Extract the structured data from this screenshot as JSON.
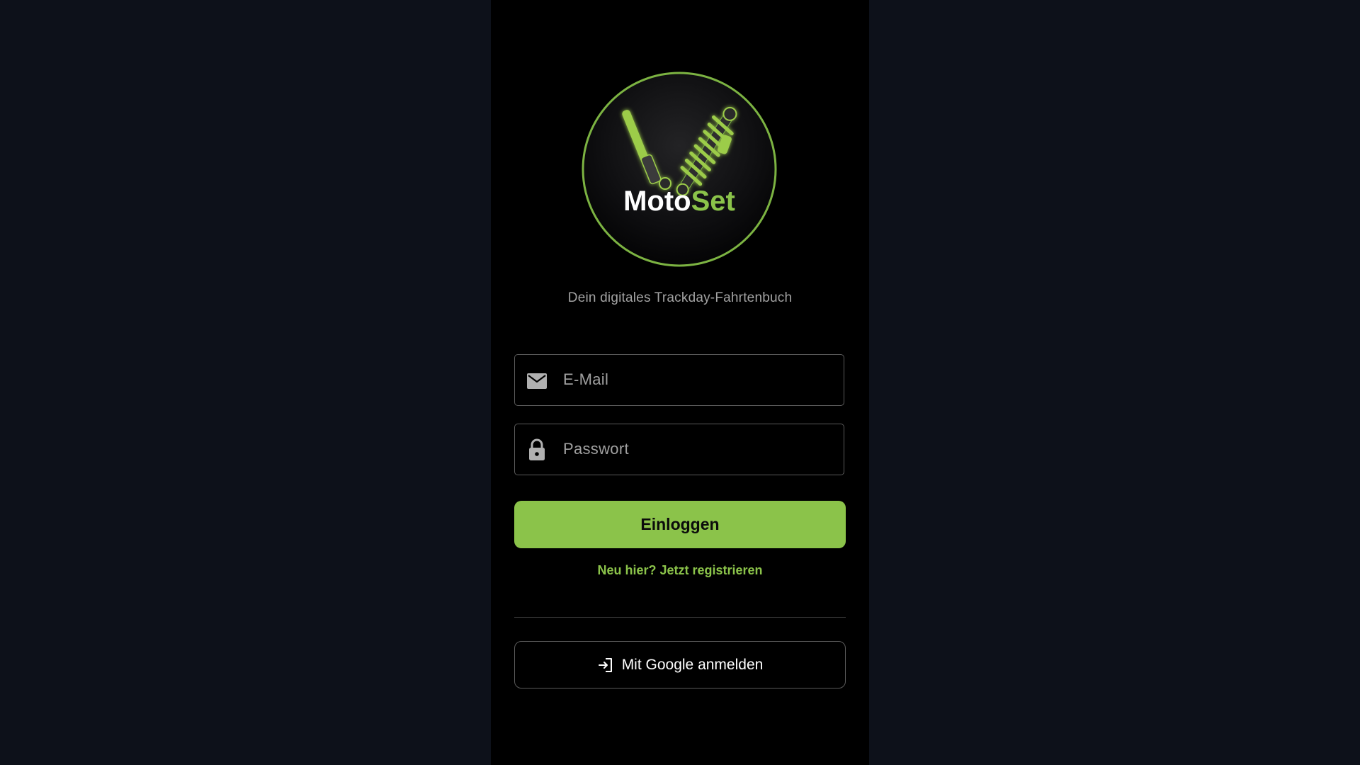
{
  "app": {
    "logo_text_primary": "Moto",
    "logo_text_accent": "Set",
    "tagline": "Dein digitales Trackday-Fahrtenbuch"
  },
  "form": {
    "email": {
      "placeholder": "E-Mail",
      "value": "",
      "icon": "mail-icon"
    },
    "password": {
      "placeholder": "Passwort",
      "value": "",
      "icon": "lock-icon"
    },
    "login_label": "Einloggen",
    "register_label": "Neu hier? Jetzt registrieren",
    "google_label": "Mit Google anmelden",
    "google_icon": "login-icon"
  },
  "colors": {
    "accent": "#8bc34a",
    "page_background": "#0d111a",
    "screen_background": "#000000"
  }
}
